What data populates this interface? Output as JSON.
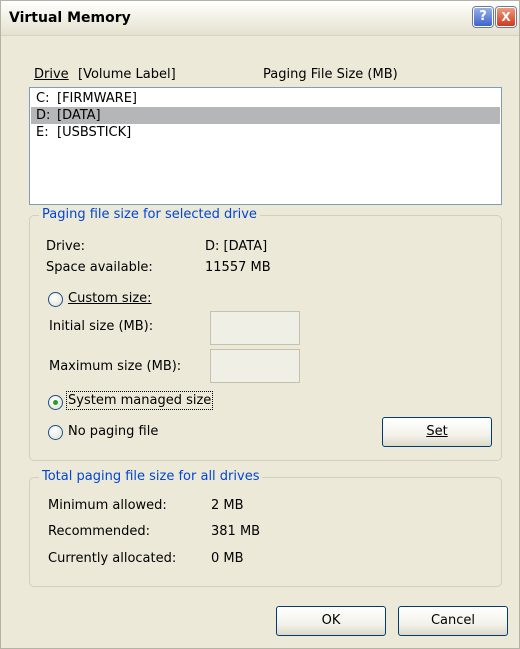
{
  "window": {
    "title": "Virtual Memory",
    "help_glyph": "?",
    "close_glyph": "X"
  },
  "drives": {
    "header_drive": "Drive",
    "header_volume": "[Volume Label]",
    "header_size": "Paging File Size (MB)",
    "rows": [
      {
        "drive": "C:",
        "label": "[FIRMWARE]",
        "selected": false
      },
      {
        "drive": "D:",
        "label": "[DATA]",
        "selected": true
      },
      {
        "drive": "E:",
        "label": "[USBSTICK]",
        "selected": false
      }
    ]
  },
  "selected_drive_group": {
    "legend": "Paging file size for selected drive",
    "drive_label": "Drive:",
    "drive_value": "D:  [DATA]",
    "space_label": "Space available:",
    "space_value": "11557 MB",
    "custom_size_label": "Custom size:",
    "initial_size_label": "Initial size (MB):",
    "initial_size_value": "",
    "maximum_size_label": "Maximum size (MB):",
    "maximum_size_value": "",
    "system_managed_label": "System managed size",
    "no_paging_label": "No paging file",
    "selected_option": "system_managed",
    "set_button": "Set"
  },
  "total_group": {
    "legend": "Total paging file size for all drives",
    "min_label": "Minimum allowed:",
    "min_value": "2 MB",
    "rec_label": "Recommended:",
    "rec_value": "381 MB",
    "alloc_label": "Currently allocated:",
    "alloc_value": "0 MB"
  },
  "buttons": {
    "ok": "OK",
    "cancel": "Cancel"
  }
}
